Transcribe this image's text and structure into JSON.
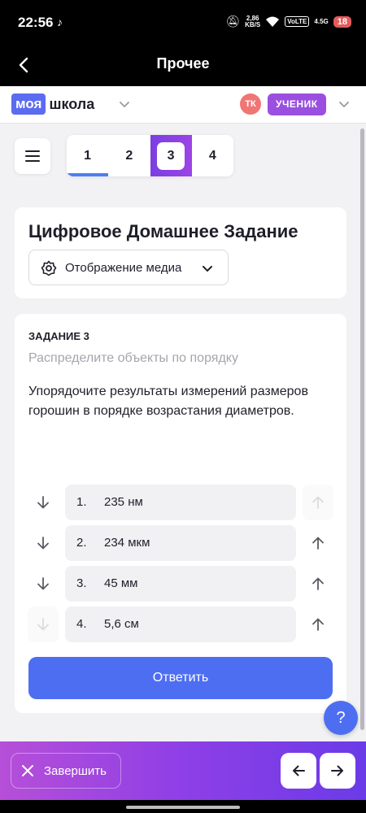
{
  "status_bar": {
    "time": "22:56",
    "net_speed_value": "2,86",
    "net_speed_unit": "KB/S",
    "volte": "VoLTE",
    "signal": "4.5G",
    "battery": "18"
  },
  "header": {
    "title": "Прочее"
  },
  "school_bar": {
    "logo_part1": "моя",
    "logo_part2": "школа",
    "avatar_initials": "ТК",
    "role": "УЧЕНИК"
  },
  "task_tabs": [
    {
      "label": "1",
      "state": "done"
    },
    {
      "label": "2",
      "state": "default"
    },
    {
      "label": "3",
      "state": "active"
    },
    {
      "label": "4",
      "state": "default"
    }
  ],
  "title_card": {
    "title": "Цифровое Домашнее Задание",
    "media_label": "Отображение медиа"
  },
  "task": {
    "number": "ЗАДАНИЕ 3",
    "subtitle": "Распределите объекты по порядку",
    "question": "Упорядочите  результаты измерений размеров горошин в порядке возрастания диаметров.",
    "items": [
      {
        "index": "1.",
        "value": "235 нм",
        "down_enabled": true,
        "up_enabled": false
      },
      {
        "index": "2.",
        "value": "234 мкм",
        "down_enabled": true,
        "up_enabled": true
      },
      {
        "index": "3.",
        "value": "45 мм",
        "down_enabled": true,
        "up_enabled": true
      },
      {
        "index": "4.",
        "value": "5,6 см",
        "down_enabled": false,
        "up_enabled": true
      }
    ],
    "answer_label": "Ответить"
  },
  "help": {
    "label": "?"
  },
  "bottom_bar": {
    "finish_label": "Завершить"
  },
  "colors": {
    "accent": "#4e6ef2",
    "role_badge": "#9a4fe0",
    "avatar": "#f07575",
    "bottom_bar_gradient": [
      "#b64fd8",
      "#6b3be8"
    ]
  }
}
